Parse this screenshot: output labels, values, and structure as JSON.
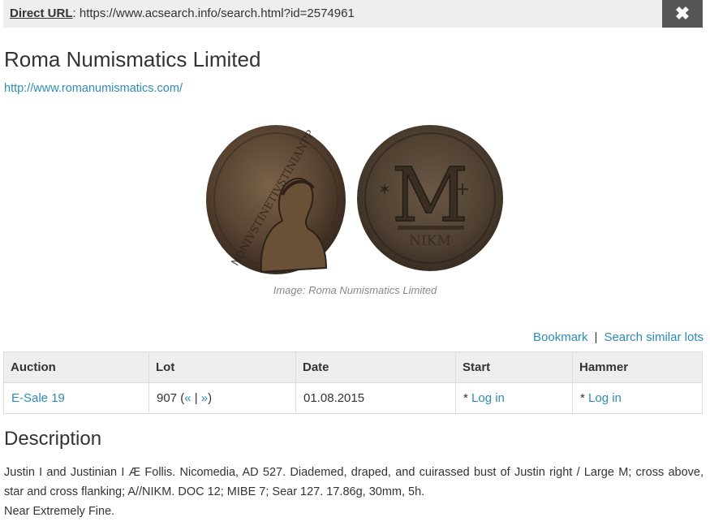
{
  "urlbar": {
    "label": "Direct URL",
    "separator": ":",
    "url": "https://www.acsearch.info/search.html?id=2574961",
    "close_icon": "close-icon"
  },
  "auctioneer": {
    "name": "Roma Numismatics Limited",
    "website": "http://www.romanumismatics.com/"
  },
  "image": {
    "caption": "Image: Roma Numismatics Limited",
    "obverse_legend": "ꓠDNIVSTINETIVSTINIANPP",
    "reverse_mark": "M",
    "reverse_exergue": "NIKM"
  },
  "actions": {
    "bookmark": "Bookmark",
    "separator": "|",
    "search_similar": "Search similar lots"
  },
  "table": {
    "headers": [
      "Auction",
      "Lot",
      "Date",
      "Start",
      "Hammer"
    ],
    "row": {
      "auction": "E-Sale 19",
      "lot_number": "907",
      "lot_open": " (",
      "prev": "«",
      "lot_sep": " | ",
      "next": "»",
      "lot_close": ")",
      "date": "01.08.2015",
      "start_prefix": "* ",
      "start_link": "Log in",
      "hammer_prefix": "* ",
      "hammer_link": "Log in"
    }
  },
  "description": {
    "heading": "Description",
    "text": "Justin I and Justinian I Æ Follis. Nicomedia, AD 527. Diademed, draped, and cuirassed bust of Justin right / Large M; cross above, star and cross flanking; A//NIKM. DOC 12; MIBE 7; Sear 127. 17.86g, 30mm, 5h.",
    "grade": "Near Extremely Fine."
  }
}
